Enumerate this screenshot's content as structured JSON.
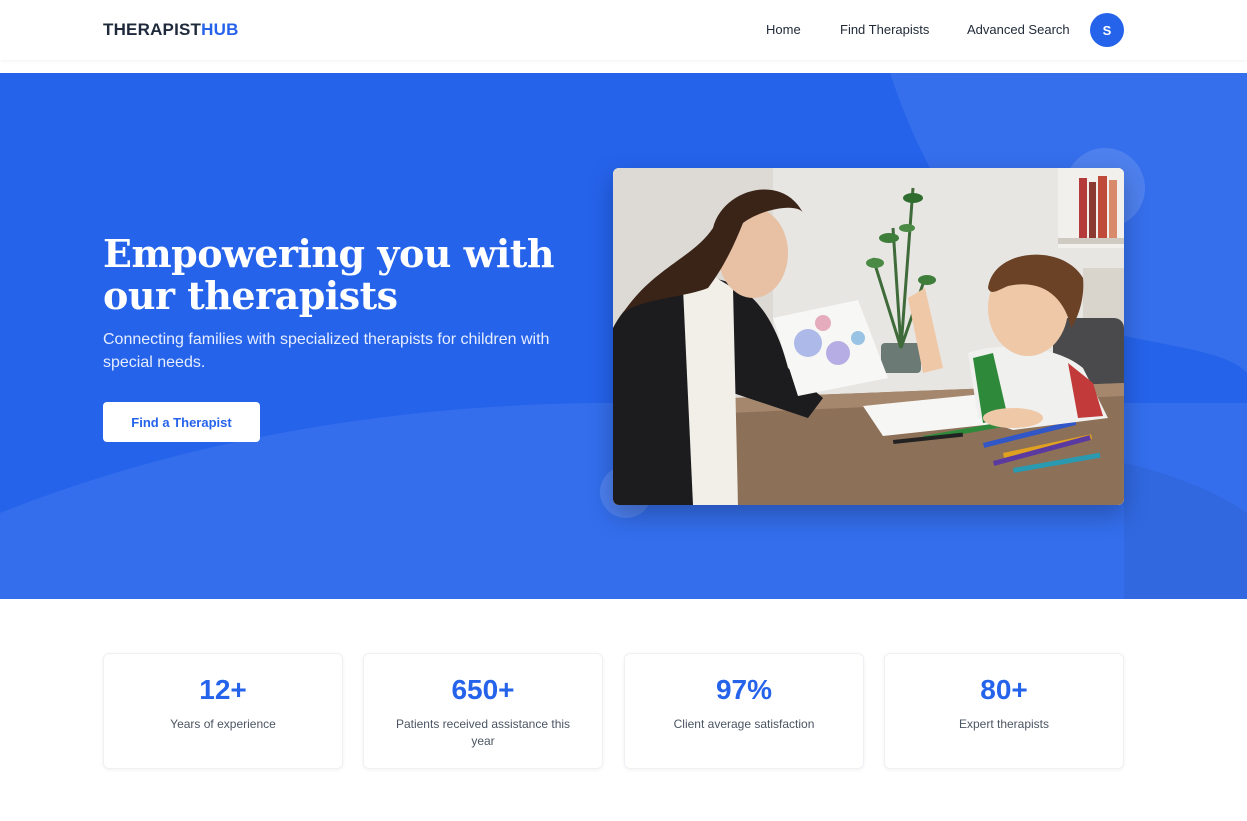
{
  "brand": {
    "part1": "THERAPIST",
    "part2": "HUB",
    "accent": "#2563eb"
  },
  "nav": {
    "links": [
      {
        "label": "Home"
      },
      {
        "label": "Find Therapists"
      },
      {
        "label": "Advanced Search"
      }
    ],
    "avatar_initial": "S"
  },
  "hero": {
    "title": "Empowering you with our therapists",
    "subtitle": "Connecting families with specialized therapists for children with special needs.",
    "cta_label": "Find a Therapist",
    "background": "#2563eb",
    "image_icon": "therapy-photo"
  },
  "stats": [
    {
      "value": "12+",
      "label": "Years of experience"
    },
    {
      "value": "650+",
      "label": "Patients received assistance this year"
    },
    {
      "value": "97%",
      "label": "Client average satisfaction"
    },
    {
      "value": "80+",
      "label": "Expert therapists"
    }
  ]
}
